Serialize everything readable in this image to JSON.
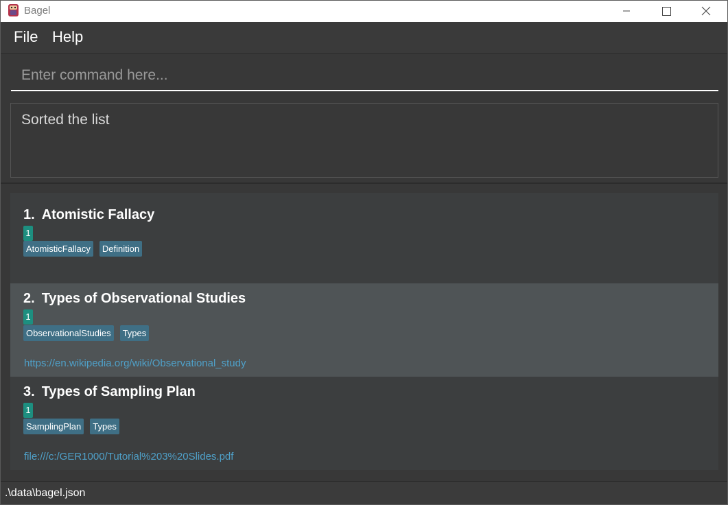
{
  "window": {
    "title": "Bagel",
    "icon": "bagel-app-icon"
  },
  "menu": {
    "items": [
      {
        "label": "File"
      },
      {
        "label": "Help"
      }
    ]
  },
  "command": {
    "placeholder": "Enter command here...",
    "value": ""
  },
  "result": {
    "message": "Sorted the list"
  },
  "flashcards": [
    {
      "index": "1.",
      "title": "Atomistic Fallacy",
      "priority": "1",
      "tags": [
        "AtomisticFallacy",
        "Definition"
      ],
      "link": "",
      "selected": false
    },
    {
      "index": "2.",
      "title": "Types of Observational Studies",
      "priority": "1",
      "tags": [
        "ObservationalStudies",
        "Types"
      ],
      "link": "https://en.wikipedia.org/wiki/Observational_study",
      "selected": true
    },
    {
      "index": "3.",
      "title": "Types of Sampling Plan",
      "priority": "1",
      "tags": [
        "SamplingPlan",
        "Types"
      ],
      "link": "file:///c:/GER1000/Tutorial%203%20Slides.pdf",
      "selected": false
    }
  ],
  "status": {
    "path": ".\\data\\bagel.json"
  },
  "colors": {
    "background": "#383838",
    "selected_card": "#4f5456",
    "priority_badge": "#1d8f80",
    "tag": "#3f6f85",
    "link": "#4fa0c8"
  }
}
